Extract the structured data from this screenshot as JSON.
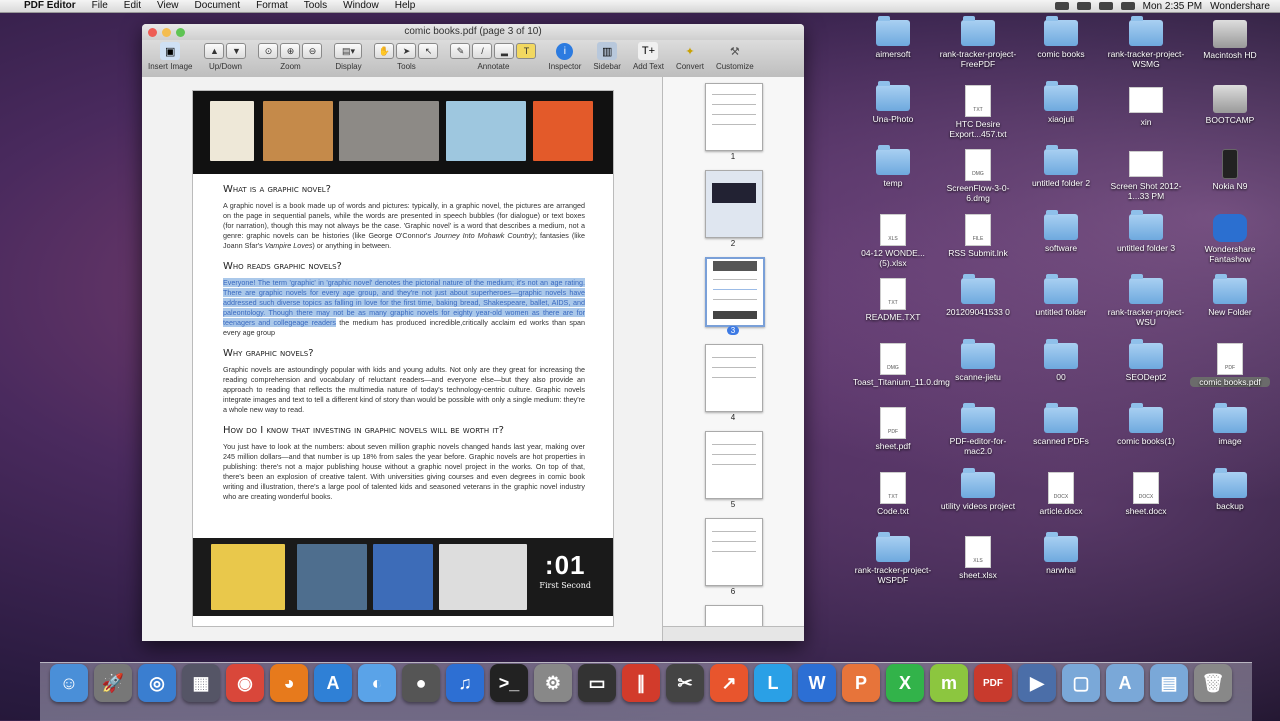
{
  "menubar": {
    "apple": "",
    "app": "PDF Editor",
    "menus": [
      "File",
      "Edit",
      "View",
      "Document",
      "Format",
      "Tools",
      "Window",
      "Help"
    ],
    "clock": "Mon 2:35 PM",
    "user": "Wondershare"
  },
  "window": {
    "title": "comic books.pdf (page 3 of 10)",
    "toolbar": {
      "insert_image": "Insert Image",
      "updown": "Up/Down",
      "zoom": "Zoom",
      "display": "Display",
      "tools": "Tools",
      "annotate": "Annotate",
      "inspector": "Inspector",
      "sidebar": "Sidebar",
      "add_text": "Add Text",
      "convert": "Convert",
      "customize": "Customize"
    }
  },
  "document": {
    "h1": "What is a graphic novel?",
    "p1a": "A graphic novel is a book made up of words and pictures: typically, in a graphic novel, the pictures are arranged on the page in sequential panels, while the words are presented in speech bubbles (for dialogue) or text boxes (for narration), though this may not always be the case. 'Graphic novel' is a word that describes a medium, not a genre: graphic novels can be histories (like George O'Connor's ",
    "p1_em1": "Journey Into Mohawk Country",
    "p1b": "); fantasies (like Joann Sfar's ",
    "p1_em2": "Vampire Loves",
    "p1c": ") or anything in between.",
    "h2": "Who reads graphic novels?",
    "p2_highlight": "Everyone! The term 'graphic' in 'graphic novel' denotes the pictorial nature of the medium; it's not an age rating. There are graphic novels for every age group, and they're not just about superheroes—graphic novels have addressed such diverse topics as falling in love for the first time, baking bread, Shakespeare, ballet, AIDS, and paleontology. Though there may not be as many graphic novels for eighty year-old women as there are for teenagers and collegeage readers",
    "p2_rest": " the medium has produced incredible,critically acclaim ed works than span every age group",
    "h3": "Why graphic novels?",
    "p3": "Graphic novels are astoundingly popular with kids and young adults. Not only are they great for increasing the reading comprehension and vocabulary of reluctant readers—and everyone else—but they also provide an approach to reading that reflects the multimedia nature of today's technology-centric culture. Graphic novels integrate images and text to tell a different kind of story than would be possible with only a single medium: they're a whole new way to read.",
    "h4": "How do I know that investing in graphic novels will be worth it?",
    "p4": "You just have to look at the numbers: about seven million graphic novels changed hands last year, making over 245 million dollars—and that number is up 18% from sales the year before. Graphic novels are hot properties in publishing: there's not a major publishing house without a graphic novel project in the works. On top of that, there's been an explosion of creative talent. With universities giving courses and even degrees in comic book writing and illustration, there's a large pool of talented kids and seasoned veterans in the graphic novel industry who are creating wonderful books.",
    "logo_num": ":01",
    "logo_text": "First Second"
  },
  "thumbnails": [
    "1",
    "2",
    "3",
    "4",
    "5",
    "6"
  ],
  "desktop": [
    {
      "label": "aimersoft",
      "kind": "folder"
    },
    {
      "label": "rank-tracker-project-FreePDF",
      "kind": "folder"
    },
    {
      "label": "comic books",
      "kind": "folder"
    },
    {
      "label": "rank-tracker-project-WSMG",
      "kind": "folder"
    },
    {
      "label": "Macintosh HD",
      "kind": "drive"
    },
    {
      "label": "Una-Photo",
      "kind": "folder"
    },
    {
      "label": "HTC Desire Export...457.txt",
      "kind": "txt"
    },
    {
      "label": "xiaojuli",
      "kind": "folder"
    },
    {
      "label": "xin",
      "kind": "shot"
    },
    {
      "label": "BOOTCAMP",
      "kind": "drive"
    },
    {
      "label": "temp",
      "kind": "folder"
    },
    {
      "label": "ScreenFlow-3-0-6.dmg",
      "kind": "dmg"
    },
    {
      "label": "untitled folder 2",
      "kind": "folder"
    },
    {
      "label": "Screen Shot 2012-1...33 PM",
      "kind": "shot"
    },
    {
      "label": "Nokia N9",
      "kind": "phone"
    },
    {
      "label": "04-12 WONDE...(5).xlsx",
      "kind": "xls"
    },
    {
      "label": "RSS Submit.lnk",
      "kind": "file"
    },
    {
      "label": "software",
      "kind": "folder"
    },
    {
      "label": "untitled folder 3",
      "kind": "folder"
    },
    {
      "label": "Wondershare Fantashow",
      "kind": "app"
    },
    {
      "label": "README.TXT",
      "kind": "txt"
    },
    {
      "label": "201209041533 0",
      "kind": "folder"
    },
    {
      "label": "untitled folder",
      "kind": "folder"
    },
    {
      "label": "rank-tracker-project-WSU",
      "kind": "folder"
    },
    {
      "label": "New Folder",
      "kind": "folder"
    },
    {
      "label": "Toast_Titanium_11.0.dmg",
      "kind": "dmg"
    },
    {
      "label": "scanne-jietu",
      "kind": "folder"
    },
    {
      "label": "00",
      "kind": "folder"
    },
    {
      "label": "SEODept2",
      "kind": "folder"
    },
    {
      "label": "comic books.pdf",
      "kind": "pdf"
    },
    {
      "label": "sheet.pdf",
      "kind": "pdf"
    },
    {
      "label": "PDF-editor-for-mac2.0",
      "kind": "folder"
    },
    {
      "label": "scanned PDFs",
      "kind": "folder"
    },
    {
      "label": "comic books(1)",
      "kind": "folder"
    },
    {
      "label": "image",
      "kind": "folder"
    },
    {
      "label": "Code.txt",
      "kind": "txt"
    },
    {
      "label": "utility videos project",
      "kind": "folder"
    },
    {
      "label": "article.docx",
      "kind": "docx"
    },
    {
      "label": "sheet.docx",
      "kind": "docx"
    },
    {
      "label": "backup",
      "kind": "folder"
    },
    {
      "label": "rank-tracker-project-WSPDF",
      "kind": "folder"
    },
    {
      "label": "sheet.xlsx",
      "kind": "xls"
    },
    {
      "label": "narwhal",
      "kind": "folder"
    }
  ],
  "dock": [
    {
      "name": "finder-icon",
      "glyph": "☺",
      "color": "#4a8fd8"
    },
    {
      "name": "launchpad-icon",
      "glyph": "🚀",
      "color": "#777"
    },
    {
      "name": "safari-icon",
      "glyph": "◎",
      "color": "#3a7ed0"
    },
    {
      "name": "photo-app-icon",
      "glyph": "▦",
      "color": "#556"
    },
    {
      "name": "chrome-icon",
      "glyph": "◉",
      "color": "#d9473a"
    },
    {
      "name": "firefox-icon",
      "glyph": "◕",
      "color": "#e77a1c"
    },
    {
      "name": "app-store-icon",
      "glyph": "A",
      "color": "#2f80d6"
    },
    {
      "name": "messages-icon",
      "glyph": "◐",
      "color": "#5aa3e8"
    },
    {
      "name": "facetime-icon",
      "glyph": "●",
      "color": "#555"
    },
    {
      "name": "itunes-icon",
      "glyph": "♫",
      "color": "#2d6fd3"
    },
    {
      "name": "terminal-icon",
      "glyph": ">_",
      "color": "#222"
    },
    {
      "name": "system-preferences-icon",
      "glyph": "⚙",
      "color": "#888"
    },
    {
      "name": "monitor-icon",
      "glyph": "▭",
      "color": "#333"
    },
    {
      "name": "parallels-icon",
      "glyph": "∥",
      "color": "#d23b2b"
    },
    {
      "name": "final-cut-icon",
      "glyph": "✂",
      "color": "#444"
    },
    {
      "name": "chart-app-icon",
      "glyph": "↗",
      "color": "#e8552d"
    },
    {
      "name": "wondershare-l-icon",
      "glyph": "L",
      "color": "#2aa0e6"
    },
    {
      "name": "wondershare-w-icon",
      "glyph": "W",
      "color": "#2c6fd4"
    },
    {
      "name": "wondershare-p-icon",
      "glyph": "P",
      "color": "#e7743a"
    },
    {
      "name": "wondershare-x-icon",
      "glyph": "X",
      "color": "#32b34a"
    },
    {
      "name": "wondershare-m-icon",
      "glyph": "m",
      "color": "#8cc63f"
    },
    {
      "name": "pdf-app-icon",
      "glyph": "PDF",
      "color": "#c83a2d"
    },
    {
      "name": "video-app-icon",
      "glyph": "▶",
      "color": "#4b6ea8"
    },
    {
      "name": "documents-stack-icon",
      "glyph": "▢",
      "color": "#7aa8d8"
    },
    {
      "name": "applications-stack-icon",
      "glyph": "A",
      "color": "#7aa8d8"
    },
    {
      "name": "downloads-stack-icon",
      "glyph": "▤",
      "color": "#7aa8d8"
    },
    {
      "name": "trash-icon",
      "glyph": "🗑",
      "color": "#888"
    }
  ]
}
